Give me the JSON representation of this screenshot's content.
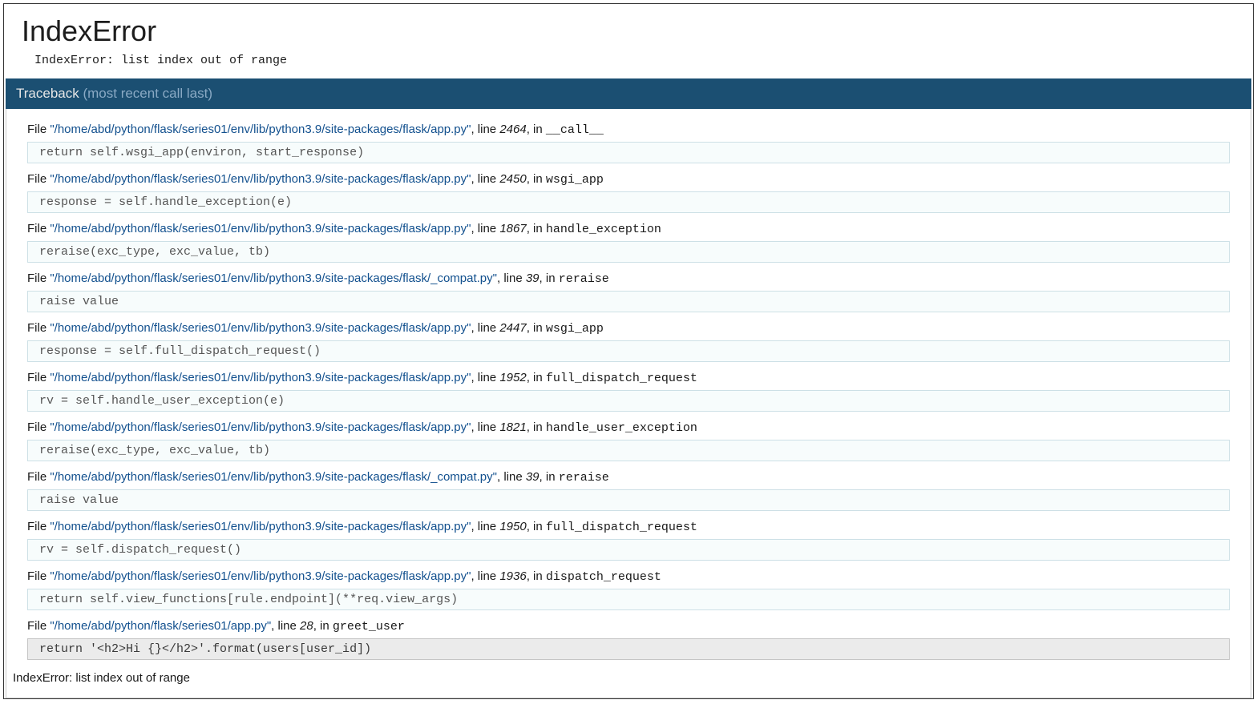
{
  "error_title": "IndexError",
  "error_message": "IndexError: list index out of range",
  "traceback_label": "Traceback",
  "traceback_sub": "(most recent call last)",
  "file_label": "File",
  "line_label": ", line",
  "in_label": ", in",
  "final_message": "IndexError: list index out of range",
  "frames": [
    {
      "file": "\"/home/abd/python/flask/series01/env/lib/python3.9/site-packages/flask/app.py\"",
      "line": "2464",
      "func": "__call__",
      "code": "return self.wsgi_app(environ, start_response)"
    },
    {
      "file": "\"/home/abd/python/flask/series01/env/lib/python3.9/site-packages/flask/app.py\"",
      "line": "2450",
      "func": "wsgi_app",
      "code": "response = self.handle_exception(e)"
    },
    {
      "file": "\"/home/abd/python/flask/series01/env/lib/python3.9/site-packages/flask/app.py\"",
      "line": "1867",
      "func": "handle_exception",
      "code": "reraise(exc_type, exc_value, tb)"
    },
    {
      "file": "\"/home/abd/python/flask/series01/env/lib/python3.9/site-packages/flask/_compat.py\"",
      "line": "39",
      "func": "reraise",
      "code": "raise value"
    },
    {
      "file": "\"/home/abd/python/flask/series01/env/lib/python3.9/site-packages/flask/app.py\"",
      "line": "2447",
      "func": "wsgi_app",
      "code": "response = self.full_dispatch_request()"
    },
    {
      "file": "\"/home/abd/python/flask/series01/env/lib/python3.9/site-packages/flask/app.py\"",
      "line": "1952",
      "func": "full_dispatch_request",
      "code": "rv = self.handle_user_exception(e)"
    },
    {
      "file": "\"/home/abd/python/flask/series01/env/lib/python3.9/site-packages/flask/app.py\"",
      "line": "1821",
      "func": "handle_user_exception",
      "code": "reraise(exc_type, exc_value, tb)"
    },
    {
      "file": "\"/home/abd/python/flask/series01/env/lib/python3.9/site-packages/flask/_compat.py\"",
      "line": "39",
      "func": "reraise",
      "code": "raise value"
    },
    {
      "file": "\"/home/abd/python/flask/series01/env/lib/python3.9/site-packages/flask/app.py\"",
      "line": "1950",
      "func": "full_dispatch_request",
      "code": "rv = self.dispatch_request()"
    },
    {
      "file": "\"/home/abd/python/flask/series01/env/lib/python3.9/site-packages/flask/app.py\"",
      "line": "1936",
      "func": "dispatch_request",
      "code": "return self.view_functions[rule.endpoint](**req.view_args)"
    },
    {
      "file": "\"/home/abd/python/flask/series01/app.py\"",
      "line": "28",
      "func": "greet_user",
      "code": "return '<h2>Hi {}</h2>'.format(users[user_id])"
    }
  ]
}
